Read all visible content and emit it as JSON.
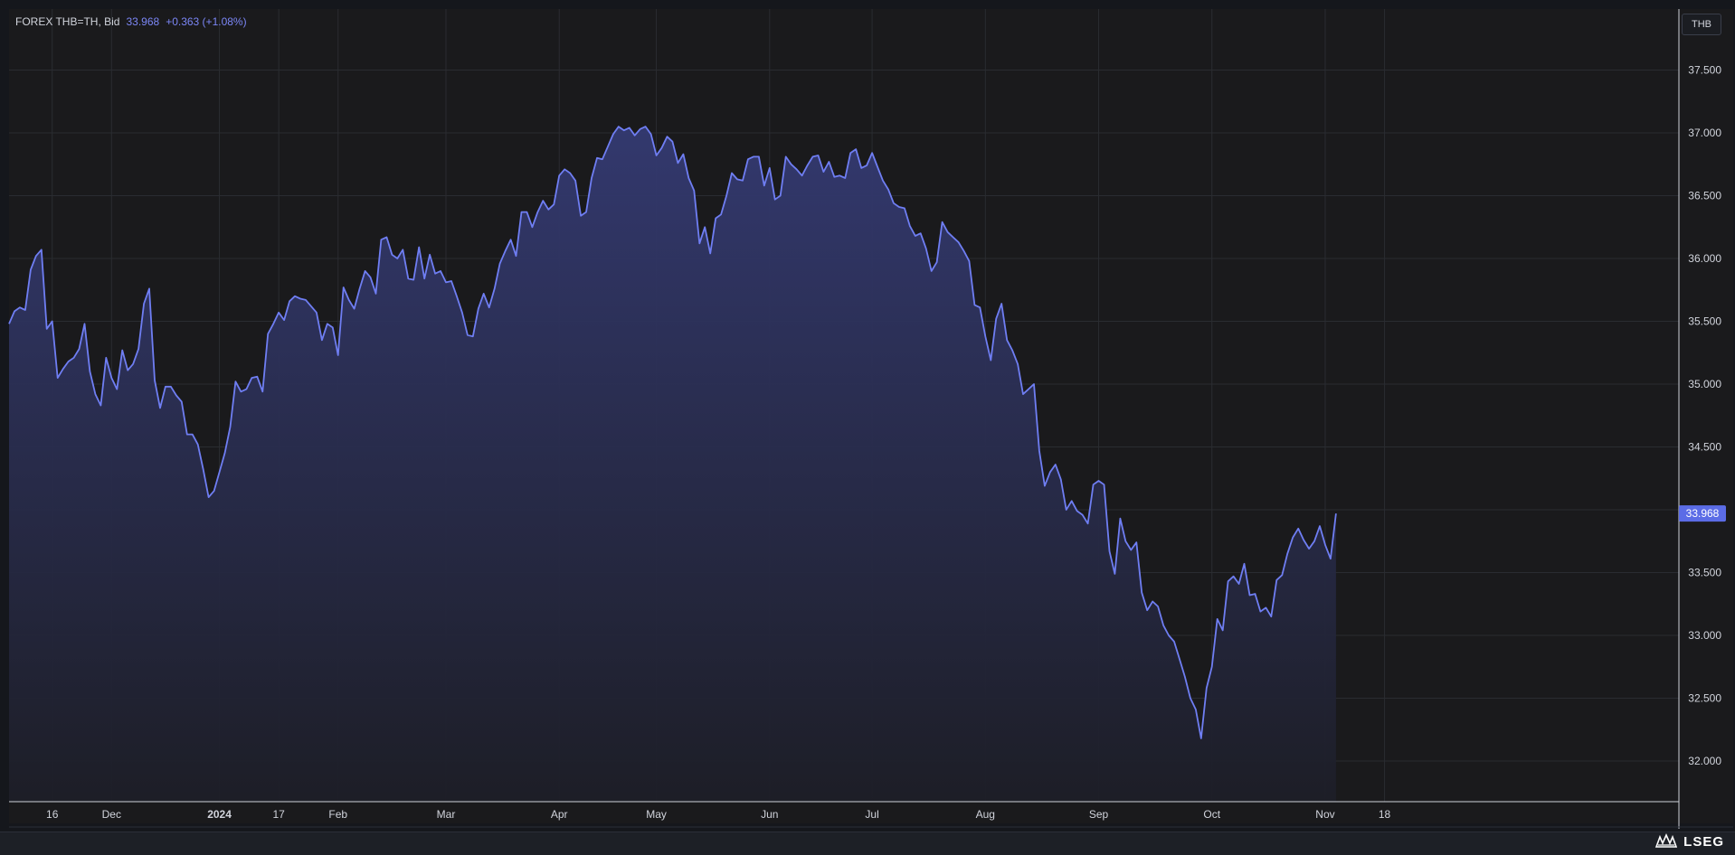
{
  "header": {
    "symbol": "FOREX THB=TH, Bid",
    "last": "33.968",
    "change": "+0.363 (+1.08%)"
  },
  "unit_button": "THB",
  "footer": {
    "logo_text": "LSEG"
  },
  "colors": {
    "background": "#1a1a1c",
    "line": "#6f7ef3",
    "grid": "#2a2c31",
    "axis_text": "#d1d4dc",
    "last_price_badge": "#5b6ce6"
  },
  "chart_data": {
    "type": "area",
    "title": "",
    "xlabel": "",
    "ylabel": "",
    "ylim": [
      31.6,
      37.95
    ],
    "y_ticks": [
      "37.500",
      "37.000",
      "36.500",
      "36.000",
      "35.500",
      "35.000",
      "34.500",
      "34.000",
      "33.500",
      "33.000",
      "32.500",
      "32.000"
    ],
    "x_ticks": [
      {
        "label": "16",
        "index": 8
      },
      {
        "label": "Dec",
        "index": 19
      },
      {
        "label": "2024",
        "index": 39
      },
      {
        "label": "17",
        "index": 50
      },
      {
        "label": "Feb",
        "index": 61
      },
      {
        "label": "Mar",
        "index": 81
      },
      {
        "label": "Apr",
        "index": 102
      },
      {
        "label": "May",
        "index": 120
      },
      {
        "label": "Jun",
        "index": 141
      },
      {
        "label": "Jul",
        "index": 160
      },
      {
        "label": "Aug",
        "index": 181
      },
      {
        "label": "Sep",
        "index": 202
      },
      {
        "label": "Oct",
        "index": 223
      },
      {
        "label": "Nov",
        "index": 244
      },
      {
        "label": "18",
        "index": 255
      }
    ],
    "last_value_label": "33.968",
    "grid": true,
    "series": [
      {
        "values": [
          35.48,
          35.58,
          35.61,
          35.59,
          35.91,
          36.02,
          36.07,
          35.44,
          35.5,
          35.05,
          35.12,
          35.18,
          35.21,
          35.28,
          35.48,
          35.1,
          34.92,
          34.83,
          35.21,
          35.05,
          34.96,
          35.27,
          35.11,
          35.16,
          35.28,
          35.64,
          35.76,
          35.03,
          34.81,
          34.98,
          34.98,
          34.91,
          34.86,
          34.6,
          34.6,
          34.52,
          34.32,
          34.1,
          34.15,
          34.3,
          34.45,
          34.66,
          35.02,
          34.94,
          34.96,
          35.05,
          35.06,
          34.94,
          35.4,
          35.48,
          35.57,
          35.51,
          35.66,
          35.7,
          35.68,
          35.67,
          35.62,
          35.57,
          35.35,
          35.48,
          35.45,
          35.23,
          35.77,
          35.67,
          35.6,
          35.76,
          35.9,
          35.85,
          35.72,
          36.15,
          36.17,
          36.03,
          36.0,
          36.07,
          35.84,
          35.83,
          36.09,
          35.84,
          36.03,
          35.88,
          35.9,
          35.81,
          35.82,
          35.7,
          35.57,
          35.39,
          35.38,
          35.6,
          35.72,
          35.61,
          35.76,
          35.96,
          36.06,
          36.15,
          36.02,
          36.37,
          36.37,
          36.25,
          36.37,
          36.46,
          36.39,
          36.43,
          36.66,
          36.71,
          36.68,
          36.62,
          36.34,
          36.37,
          36.64,
          36.8,
          36.79,
          36.89,
          36.99,
          37.05,
          37.02,
          37.04,
          36.98,
          37.03,
          37.05,
          36.99,
          36.82,
          36.88,
          36.97,
          36.93,
          36.76,
          36.83,
          36.64,
          36.54,
          36.12,
          36.25,
          36.04,
          36.32,
          36.35,
          36.5,
          36.68,
          36.63,
          36.62,
          36.79,
          36.81,
          36.81,
          36.58,
          36.72,
          36.47,
          36.5,
          36.81,
          36.75,
          36.71,
          36.66,
          36.74,
          36.81,
          36.82,
          36.69,
          36.77,
          36.65,
          36.66,
          36.64,
          36.84,
          36.87,
          36.72,
          36.74,
          36.84,
          36.73,
          36.62,
          36.55,
          36.44,
          36.41,
          36.4,
          36.26,
          36.18,
          36.2,
          36.08,
          35.9,
          35.97,
          36.29,
          36.21,
          36.17,
          36.13,
          36.06,
          35.98,
          35.63,
          35.61,
          35.38,
          35.19,
          35.52,
          35.64,
          35.35,
          35.27,
          35.16,
          34.92,
          34.96,
          35.0,
          34.47,
          34.19,
          34.3,
          34.36,
          34.24,
          34.0,
          34.07,
          33.99,
          33.96,
          33.89,
          34.2,
          34.23,
          34.2,
          33.67,
          33.49,
          33.93,
          33.75,
          33.68,
          33.74,
          33.34,
          33.2,
          33.27,
          33.23,
          33.08,
          33.0,
          32.95,
          32.81,
          32.67,
          32.5,
          32.41,
          32.18,
          32.58,
          32.75,
          33.13,
          33.04,
          33.43,
          33.47,
          33.41,
          33.57,
          33.32,
          33.33,
          33.19,
          33.22,
          33.15,
          33.44,
          33.48,
          33.65,
          33.78,
          33.85,
          33.76,
          33.69,
          33.75,
          33.87,
          33.72,
          33.61,
          33.97
        ]
      }
    ]
  }
}
